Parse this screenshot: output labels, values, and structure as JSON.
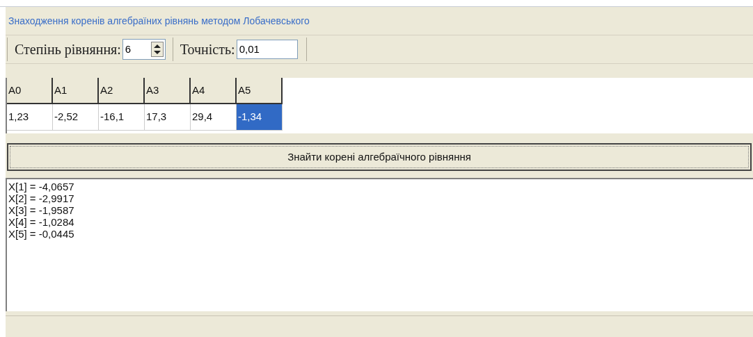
{
  "title": "Знаходження коренів алгебраїних рівнянь методом Лобачевського",
  "toolbar": {
    "degree_label": "Степінь рівняння:",
    "degree_value": "6",
    "precision_label": "Точність:",
    "precision_value": "0,01"
  },
  "grid": {
    "columns": [
      "A0",
      "A1",
      "A2",
      "A3",
      "A4",
      "A5"
    ],
    "cells": [
      {
        "value": "1,23",
        "selected": false
      },
      {
        "value": "-2,52",
        "selected": false
      },
      {
        "value": "-16,1",
        "selected": false
      },
      {
        "value": "17,3",
        "selected": false
      },
      {
        "value": "29,4",
        "selected": false
      },
      {
        "value": "-1,34",
        "selected": true
      }
    ]
  },
  "button": "Знайти корені алгебраїчного рівняння",
  "results": [
    "X[1] = -4,0657",
    "X[2] = -2,9917",
    "X[3] = -1,9587",
    "X[4] = -1,0284",
    "X[5] = -0,0445"
  ]
}
